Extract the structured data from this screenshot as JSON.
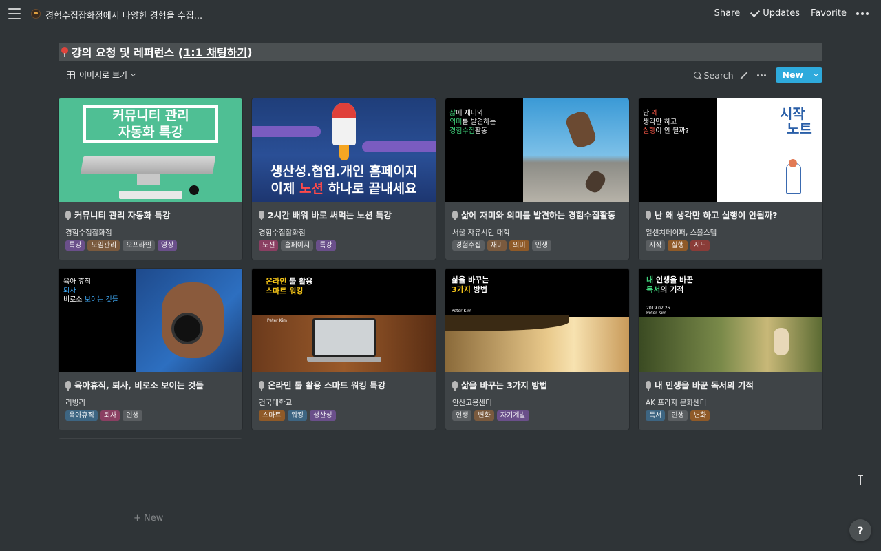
{
  "topbar": {
    "breadcrumb": "경험수집잡화점에서 다양한 경험을 수집...",
    "share": "Share",
    "updates": "Updates",
    "favorite": "Favorite"
  },
  "database": {
    "title_prefix": "강의 요청 및 레퍼런스 (",
    "title_link": "1:1 채팅하기",
    "title_suffix": ")"
  },
  "view": {
    "name": "이미지로 보기",
    "search": "Search",
    "new_label": "New"
  },
  "tag_colors": {
    "purple": "#6a4f8a",
    "brown": "#7a5a3e",
    "gray": "#5a5e61",
    "pink": "#8a3f62",
    "orange": "#8f5a28",
    "red": "#8a3c38",
    "blue": "#3d6582"
  },
  "cards": [
    {
      "title": "커뮤니티 관리 자동화 특강",
      "subtitle": "경험수집잡화점",
      "tags": [
        "특강",
        "모임관리",
        "오프라인",
        "영상"
      ],
      "cover_text": [
        "커뮤니티 관리",
        "자동화 특강"
      ]
    },
    {
      "title": "2시간 배워 바로 써먹는 노션 특강",
      "subtitle": "경험수집잡화점",
      "tags": [
        "노션",
        "홈페이지",
        "특강"
      ],
      "cover_text": [
        "생산성.협업.개인 홈페이지",
        "이제 ",
        "노션",
        " 하나로 끝내세요"
      ]
    },
    {
      "title": "삶에 재미와 의미를 발견하는 경험수집활동",
      "subtitle": "서울 자유시민 대학",
      "tags": [
        "경험수집",
        "재미",
        "의미",
        "인생"
      ],
      "cover_text": [
        "삶",
        "에 재미와",
        "의미",
        "를 발견하는",
        "경험수집",
        "활동"
      ]
    },
    {
      "title": "난 왜 생각만 하고 실행이 안될까?",
      "subtitle": "일센치페이퍼, 스몰스텝",
      "tags": [
        "시작",
        "실행",
        "시도"
      ],
      "cover_text": [
        "난 ",
        "왜",
        "생각만 하고",
        "실행",
        "이 안 될까?",
        "시작",
        "노트"
      ]
    },
    {
      "title": "육아휴직, 퇴사, 비로소 보이는 것들",
      "subtitle": "리빙리",
      "tags": [
        "육아휴직",
        "퇴사",
        "인생"
      ],
      "cover_text": [
        "육아 휴직",
        "퇴사",
        "비로소 ",
        "보이는 것들"
      ]
    },
    {
      "title": "온라인 툴 활용 스마트 워킹 특강",
      "subtitle": "건국대학교",
      "tags": [
        "스마트",
        "워킹",
        "생산성"
      ],
      "cover_text": [
        "온라인",
        " 툴 활용",
        "스마트 워킹",
        "Peter Kim"
      ]
    },
    {
      "title": "삶을 바꾸는 3가지 방법",
      "subtitle": "안산고용센터",
      "tags": [
        "인생",
        "변화",
        "자기계발"
      ],
      "cover_text": [
        "삶을 바꾸는",
        "3가지",
        " 방법",
        "Peter Kim"
      ]
    },
    {
      "title": "내 인생을 바꾼 독서의 기적",
      "subtitle": "AK 프라자 문화센터",
      "tags": [
        "독서",
        "인생",
        "변화"
      ],
      "cover_text": [
        "내",
        " 인생을 바꾼",
        "독서",
        "의 기적",
        "2019.02.26",
        "Peter Kim"
      ]
    }
  ],
  "add_card": {
    "label": "New"
  },
  "help": {
    "label": "?"
  }
}
